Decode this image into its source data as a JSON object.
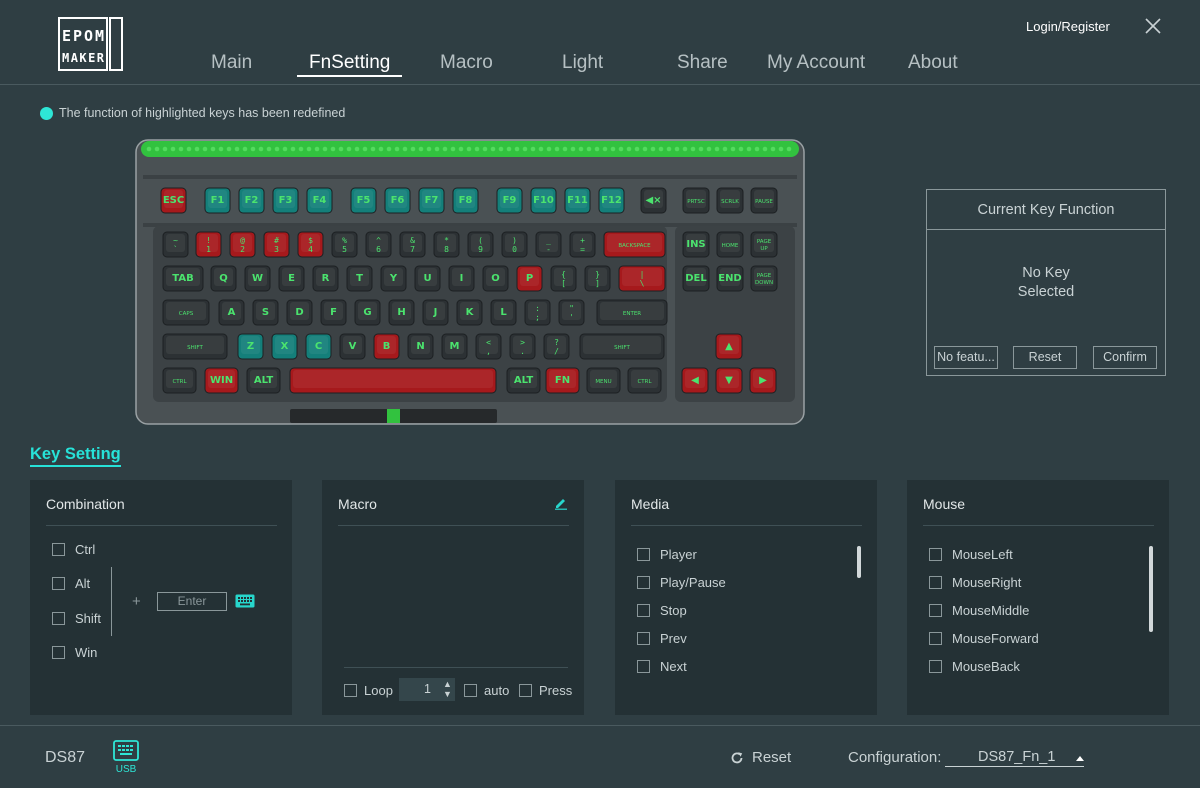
{
  "app": {
    "logo_lines": [
      "EPOM",
      "MAKER"
    ],
    "login_label": "Login/Register",
    "close_icon": "close-icon"
  },
  "nav": {
    "items": [
      "Main",
      "FnSetting",
      "Macro",
      "Light",
      "Share",
      "My Account",
      "About"
    ],
    "active": "FnSetting"
  },
  "notice": "The function of highlighted keys has been redefined",
  "keyboard": {
    "rows": [
      [
        {
          "l": "ESC",
          "c": "red"
        },
        {
          "l": "F1",
          "c": "teal"
        },
        {
          "l": "F2",
          "c": "teal"
        },
        {
          "l": "F3",
          "c": "teal"
        },
        {
          "l": "F4",
          "c": "teal"
        },
        {
          "l": "F5",
          "c": "teal"
        },
        {
          "l": "F6",
          "c": "teal"
        },
        {
          "l": "F7",
          "c": "teal"
        },
        {
          "l": "F8",
          "c": "teal"
        },
        {
          "l": "F9",
          "c": "teal"
        },
        {
          "l": "F10",
          "c": "teal"
        },
        {
          "l": "F11",
          "c": "teal"
        },
        {
          "l": "F12",
          "c": "teal"
        },
        {
          "l": "◀×",
          "c": "gray"
        },
        {
          "l": "PRTSC",
          "c": "gray"
        },
        {
          "l": "SCRLK",
          "c": "gray"
        },
        {
          "l": "PAUSE",
          "c": "gray"
        }
      ],
      [
        {
          "l": "~ `",
          "c": "gray"
        },
        {
          "l": "! 1",
          "c": "red"
        },
        {
          "l": "@ 2",
          "c": "red"
        },
        {
          "l": "# 3",
          "c": "red"
        },
        {
          "l": "$ 4",
          "c": "red"
        },
        {
          "l": "% 5",
          "c": "gray"
        },
        {
          "l": "^ 6",
          "c": "gray"
        },
        {
          "l": "& 7",
          "c": "gray"
        },
        {
          "l": "* 8",
          "c": "gray"
        },
        {
          "l": "( 9",
          "c": "gray"
        },
        {
          "l": ") 0",
          "c": "gray"
        },
        {
          "l": "_ -",
          "c": "gray"
        },
        {
          "l": "+ =",
          "c": "gray"
        },
        {
          "l": "BACKSPACE",
          "c": "red"
        },
        {
          "l": "INS",
          "c": "gray"
        },
        {
          "l": "HOME",
          "c": "gray"
        },
        {
          "l": "PAGE UP",
          "c": "gray"
        }
      ],
      [
        {
          "l": "TAB",
          "c": "gray"
        },
        {
          "l": "Q",
          "c": "gray"
        },
        {
          "l": "W",
          "c": "gray"
        },
        {
          "l": "E",
          "c": "gray"
        },
        {
          "l": "R",
          "c": "gray"
        },
        {
          "l": "T",
          "c": "gray"
        },
        {
          "l": "Y",
          "c": "gray"
        },
        {
          "l": "U",
          "c": "gray"
        },
        {
          "l": "I",
          "c": "gray"
        },
        {
          "l": "O",
          "c": "gray"
        },
        {
          "l": "P",
          "c": "red"
        },
        {
          "l": "{ [",
          "c": "gray"
        },
        {
          "l": "} ]",
          "c": "gray"
        },
        {
          "l": "| \\",
          "c": "red"
        },
        {
          "l": "DEL",
          "c": "gray"
        },
        {
          "l": "END",
          "c": "gray"
        },
        {
          "l": "PAGE DOWN",
          "c": "gray"
        }
      ],
      [
        {
          "l": "CAPS",
          "c": "gray"
        },
        {
          "l": "A",
          "c": "gray"
        },
        {
          "l": "S",
          "c": "gray"
        },
        {
          "l": "D",
          "c": "gray"
        },
        {
          "l": "F",
          "c": "gray"
        },
        {
          "l": "G",
          "c": "gray"
        },
        {
          "l": "H",
          "c": "gray"
        },
        {
          "l": "J",
          "c": "gray"
        },
        {
          "l": "K",
          "c": "gray"
        },
        {
          "l": "L",
          "c": "gray"
        },
        {
          "l": ": ;",
          "c": "gray"
        },
        {
          "l": "\" '",
          "c": "gray"
        },
        {
          "l": "ENTER",
          "c": "gray"
        }
      ],
      [
        {
          "l": "SHIFT",
          "c": "gray"
        },
        {
          "l": "Z",
          "c": "teal"
        },
        {
          "l": "X",
          "c": "teal"
        },
        {
          "l": "C",
          "c": "teal"
        },
        {
          "l": "V",
          "c": "gray"
        },
        {
          "l": "B",
          "c": "red"
        },
        {
          "l": "N",
          "c": "gray"
        },
        {
          "l": "M",
          "c": "gray"
        },
        {
          "l": "< ,",
          "c": "gray"
        },
        {
          "l": "> .",
          "c": "gray"
        },
        {
          "l": "? /",
          "c": "gray"
        },
        {
          "l": "SHIFT",
          "c": "gray"
        },
        {
          "l": "▲",
          "c": "red"
        }
      ],
      [
        {
          "l": "CTRL",
          "c": "gray"
        },
        {
          "l": "WIN",
          "c": "red"
        },
        {
          "l": "ALT",
          "c": "gray"
        },
        {
          "l": "",
          "c": "red"
        },
        {
          "l": "ALT",
          "c": "gray"
        },
        {
          "l": "FN",
          "c": "red"
        },
        {
          "l": "MENU",
          "c": "gray"
        },
        {
          "l": "CTRL",
          "c": "gray"
        },
        {
          "l": "◀",
          "c": "red"
        },
        {
          "l": "▼",
          "c": "red"
        },
        {
          "l": "▶",
          "c": "red"
        }
      ]
    ],
    "colors": {
      "gray": "#2c3134",
      "red": "#a6191c",
      "teal": "#147f7a",
      "legend": "#4be36e",
      "frame": "#565d60",
      "glow": "#32c23f"
    }
  },
  "current_key": {
    "title": "Current Key Function",
    "status_line1": "No Key",
    "status_line2": "Selected",
    "buttons": [
      "No featu...",
      "Reset",
      "Confirm"
    ]
  },
  "key_setting": {
    "title": "Key Setting",
    "combination": {
      "title": "Combination",
      "modifiers": [
        "Ctrl",
        "Alt",
        "Shift",
        "Win"
      ],
      "plus": "+",
      "key_placeholder": "Enter",
      "keyboard_icon": "keyboard-icon"
    },
    "macro": {
      "title": "Macro",
      "edit_icon": "pencil-icon",
      "loop_label": "Loop",
      "loop_value": "1",
      "auto_label": "auto",
      "press_label": "Press"
    },
    "media": {
      "title": "Media",
      "items": [
        "Player",
        "Play/Pause",
        "Stop",
        "Prev",
        "Next"
      ]
    },
    "mouse": {
      "title": "Mouse",
      "items": [
        "MouseLeft",
        "MouseRight",
        "MouseMiddle",
        "MouseForward",
        "MouseBack"
      ]
    }
  },
  "footer": {
    "model": "DS87",
    "connection": "USB",
    "reset_label": "Reset",
    "config_label": "Configuration:",
    "config_value": "DS87_Fn_1"
  }
}
